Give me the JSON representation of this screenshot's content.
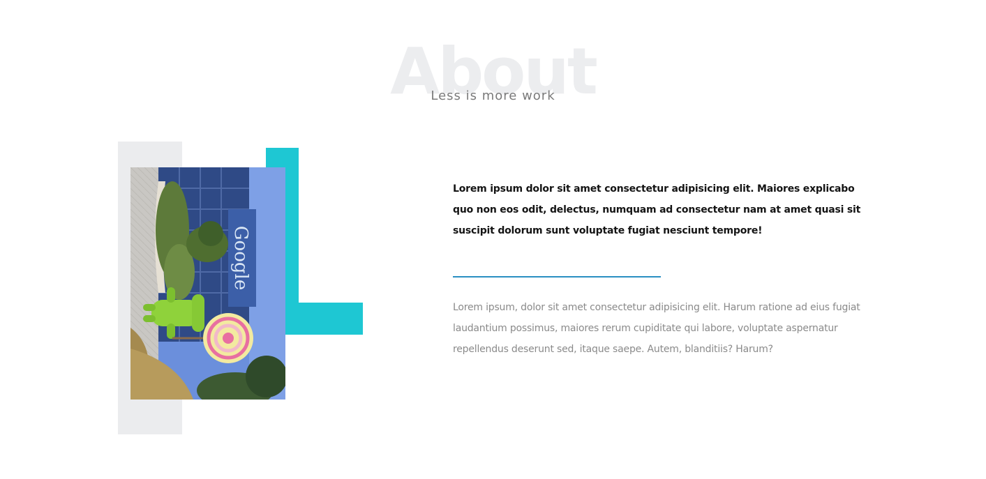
{
  "section": {
    "title": "About",
    "subtitle": "Less is more work"
  },
  "photo": {
    "sign_text": "Google"
  },
  "content": {
    "lead": "Lorem ipsum dolor sit amet consectetur adipisicing elit. Maiores explicabo quo non eos odit, delectus, numquam ad consectetur nam at amet quasi sit suscipit dolorum sunt voluptate fugiat nesciunt tempore!",
    "body": "Lorem ipsum, dolor sit amet consectetur adipisicing elit. Harum ratione ad eius fugiat laudantium possimus, maiores rerum cupiditate qui labore, voluptate aspernatur repellendus deserunt sed, itaque saepe. Autem, blanditiis? Harum?"
  },
  "colors": {
    "accent_teal": "#1ec7d3",
    "divider_blue": "#2a8fc2",
    "decor_gray": "#ebecee",
    "title_watermark": "#ecedef"
  }
}
